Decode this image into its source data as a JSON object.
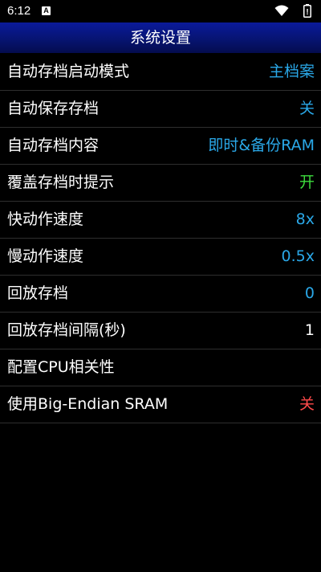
{
  "status_bar": {
    "time": "6:12",
    "notification_icon_letter": "A",
    "icons": [
      "a-notification-icon",
      "wifi-icon",
      "battery-icon"
    ]
  },
  "header": {
    "title": "系统设置"
  },
  "colors": {
    "blue_value": "#2aa8e8",
    "green_value": "#3ddc3d",
    "red_value": "#ff4a4a",
    "white_value": "#ffffff",
    "title_bar": "#071472"
  },
  "settings": [
    {
      "label": "自动存档启动模式",
      "value": "主档案",
      "color": "#2aa8e8"
    },
    {
      "label": "自动保存存档",
      "value": "关",
      "color": "#2aa8e8"
    },
    {
      "label": "自动存档内容",
      "value": "即时&备份RAM",
      "color": "#2aa8e8"
    },
    {
      "label": "覆盖存档时提示",
      "value": "开",
      "color": "#3ddc3d"
    },
    {
      "label": "快动作速度",
      "value": "8x",
      "color": "#2aa8e8"
    },
    {
      "label": "慢动作速度",
      "value": "0.5x",
      "color": "#2aa8e8"
    },
    {
      "label": "回放存档",
      "value": "0",
      "color": "#2aa8e8"
    },
    {
      "label": "回放存档间隔(秒)",
      "value": "1",
      "color": "#ffffff"
    },
    {
      "label": "配置CPU相关性",
      "value": "",
      "color": "#ffffff"
    },
    {
      "label": "使用Big-Endian SRAM",
      "value": "关",
      "color": "#ff4a4a"
    }
  ]
}
